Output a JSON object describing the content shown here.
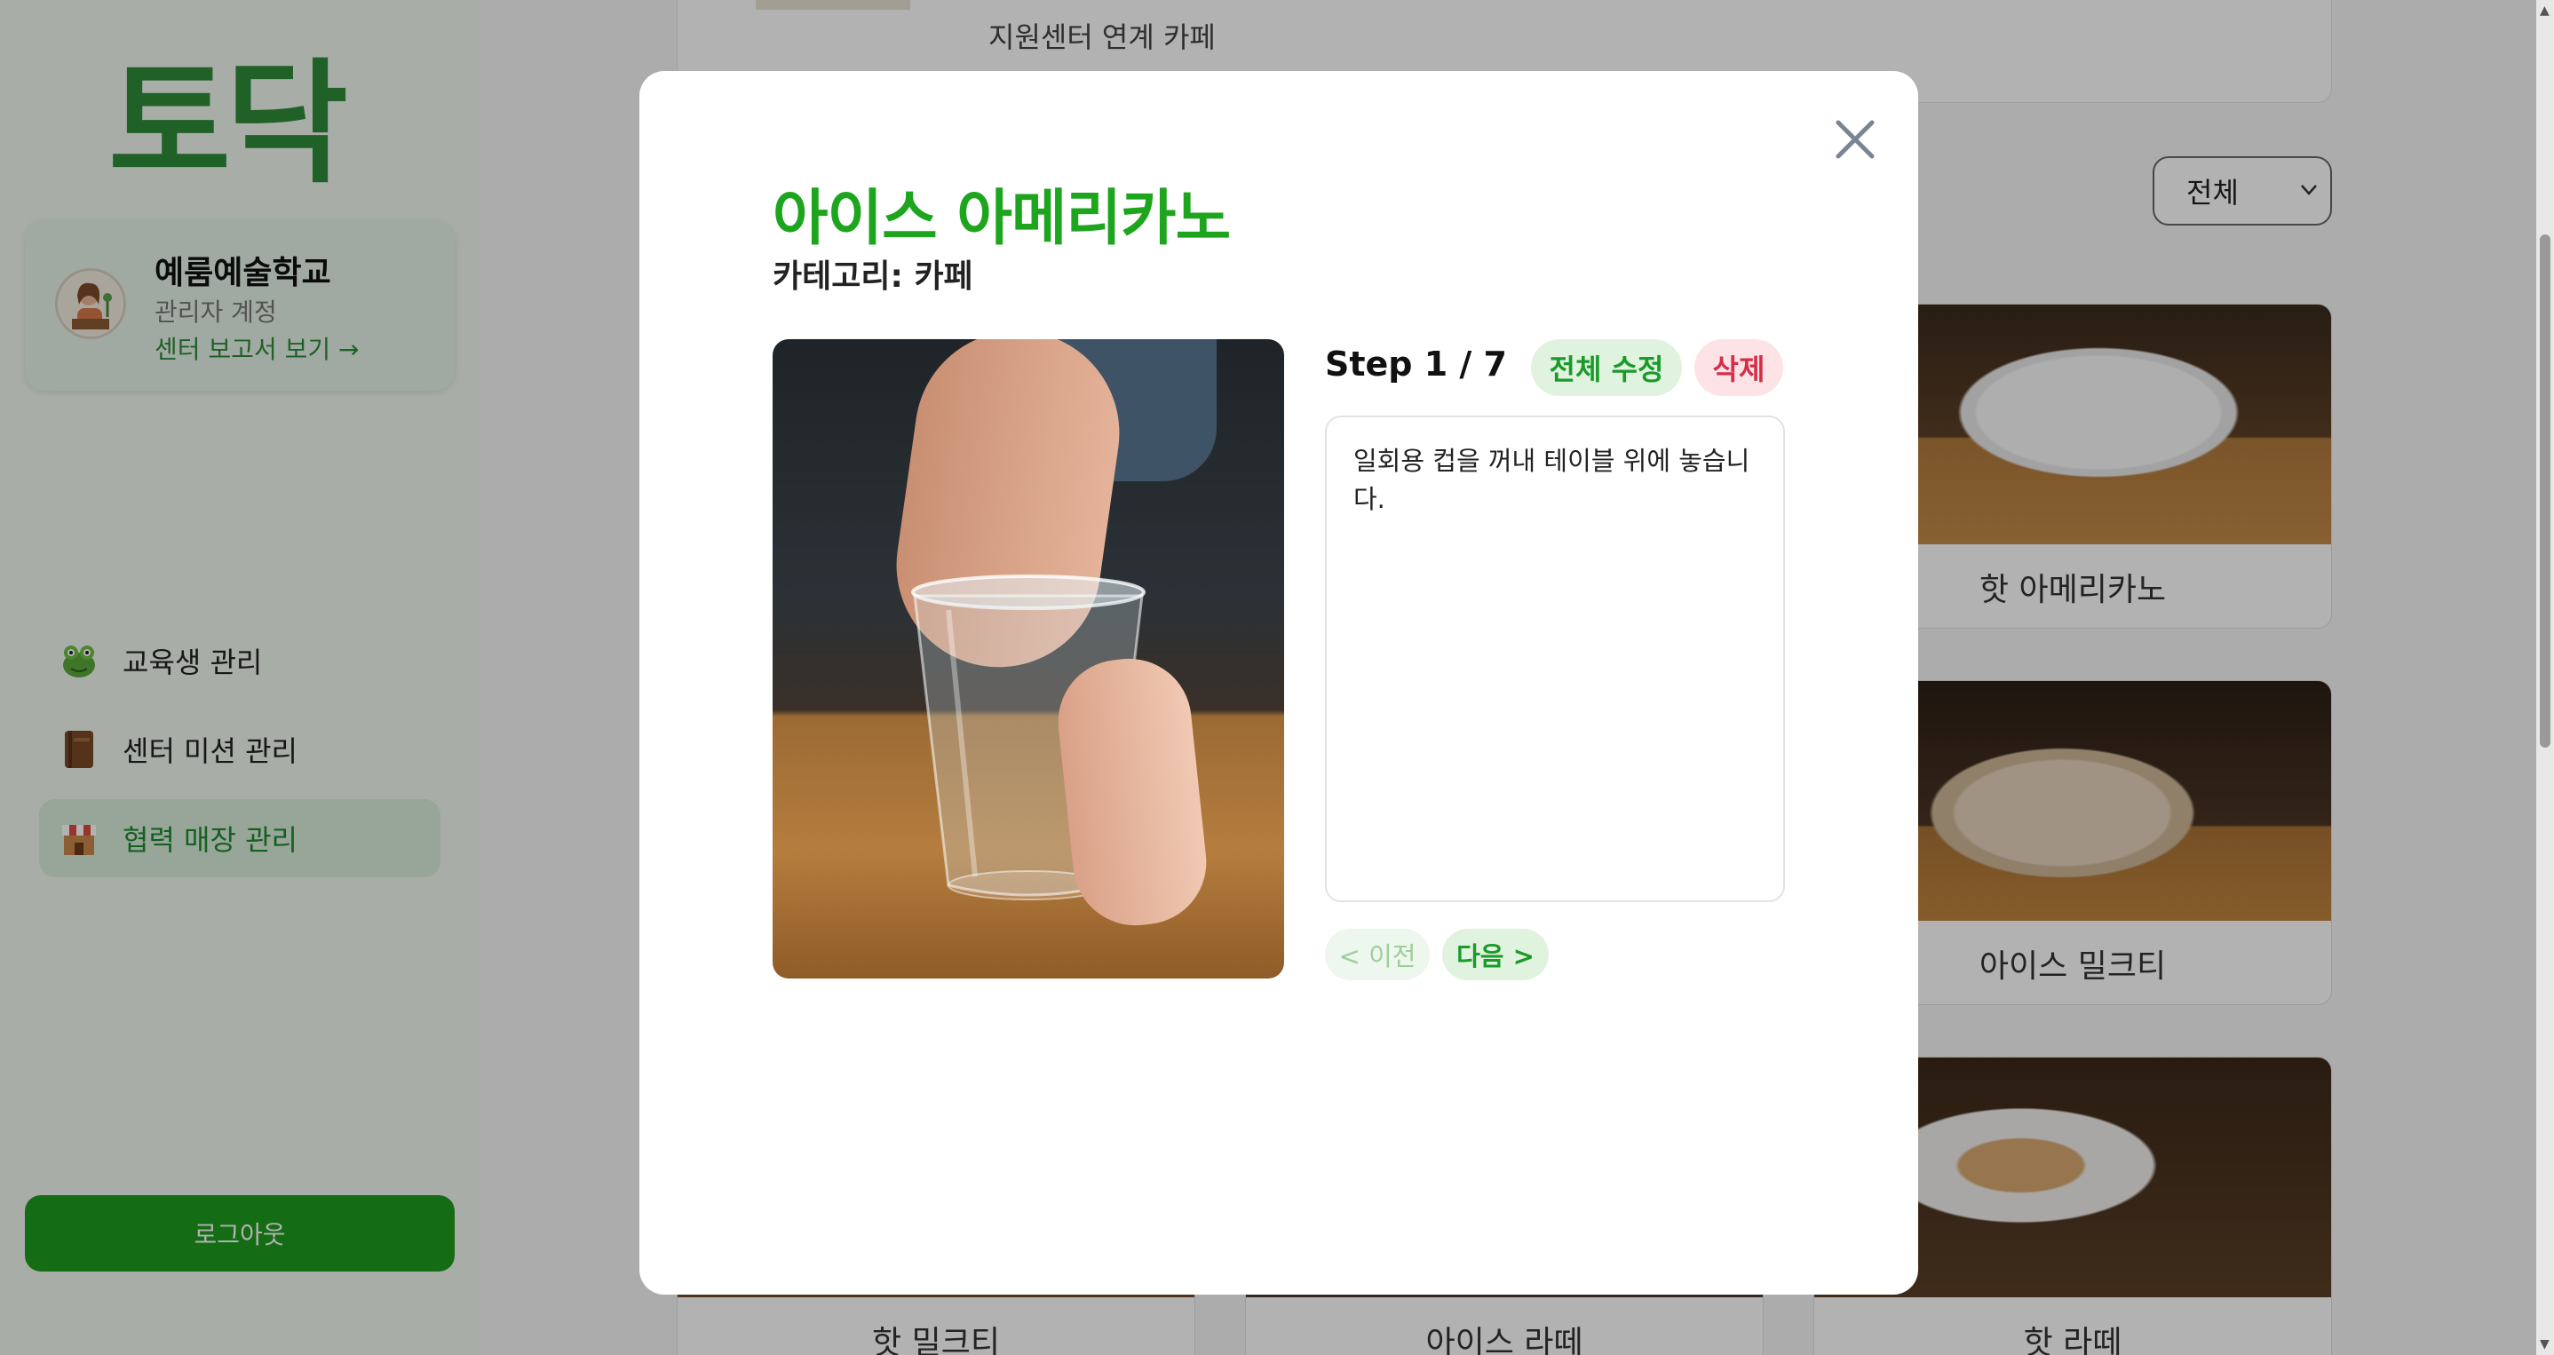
{
  "sidebar": {
    "logo": "토닥",
    "profile": {
      "name": "예룸예술학교",
      "role": "관리자 계정",
      "report_link": "센터 보고서 보기 →"
    },
    "nav": [
      {
        "label": "교육생 관리",
        "icon": "frog-icon"
      },
      {
        "label": "센터 미션 관리",
        "icon": "book-icon"
      },
      {
        "label": "협력 매장 관리",
        "icon": "store-icon",
        "active": true
      }
    ],
    "logout_label": "로그아웃"
  },
  "main": {
    "top_card_label": "지원센터 연계 카페",
    "filter": {
      "selected": "전체"
    },
    "cards": [
      {
        "label": "핫 아메리카노"
      },
      {
        "label": "아이스 밀크티"
      },
      {
        "label": "핫 밀크티"
      },
      {
        "label": "아이스 라떼"
      },
      {
        "label": "핫 라떼"
      }
    ]
  },
  "modal": {
    "title": "아이스 아메리카노",
    "category_label": "카테고리:",
    "category_value": "카페",
    "step_label": "Step 1 / 7",
    "edit_all_label": "전체 수정",
    "delete_label": "삭제",
    "step_text": "일회용 컵을 꺼내 테이블 위에 놓습니다.",
    "prev_label": "< 이전",
    "next_label": "다음 >",
    "close_icon": "close-icon"
  },
  "colors": {
    "brand_green": "#1ea51e",
    "logo_green": "#2e8b3a",
    "delete_red": "#d62d48",
    "overlay": "rgba(0,0,0,0.30)"
  }
}
